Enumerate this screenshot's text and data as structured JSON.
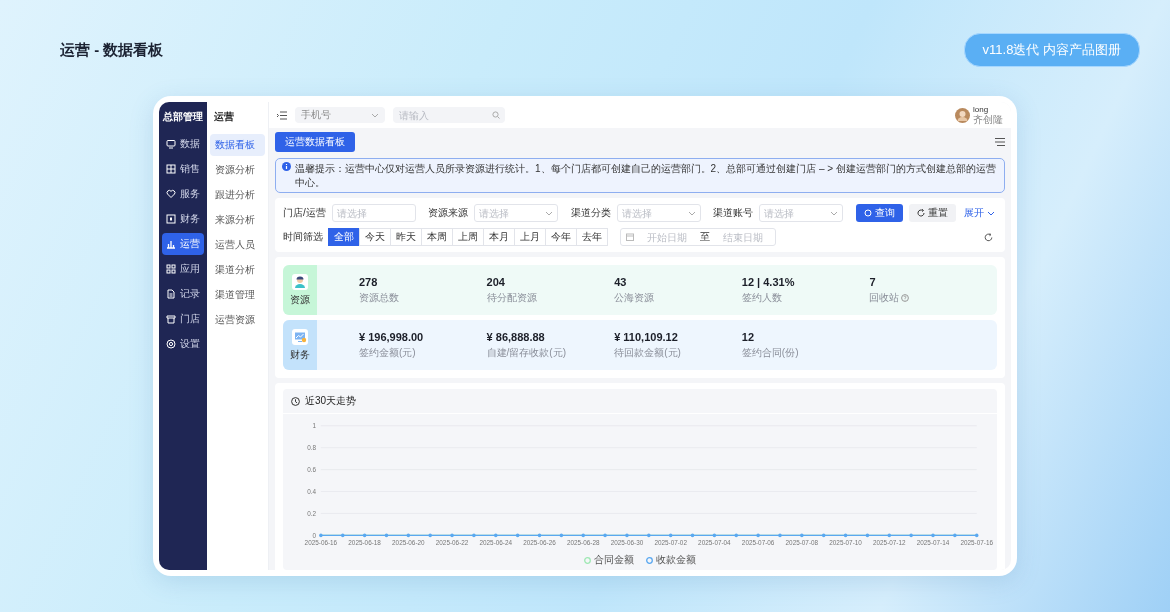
{
  "page": {
    "title": "运营 - 数据看板",
    "badge": "v11.8迭代 内容产品图册"
  },
  "app": {
    "brand": "总部管理",
    "nav": [
      {
        "label": "数据",
        "selected": false
      },
      {
        "label": "销售",
        "selected": false
      },
      {
        "label": "服务",
        "selected": false
      },
      {
        "label": "财务",
        "selected": false
      },
      {
        "label": "运营",
        "selected": true
      },
      {
        "label": "应用",
        "selected": false
      },
      {
        "label": "记录",
        "selected": false
      },
      {
        "label": "门店",
        "selected": false
      },
      {
        "label": "设置",
        "selected": false
      }
    ],
    "submenu": {
      "title": "运营",
      "items": [
        {
          "label": "数据看板",
          "selected": true
        },
        {
          "label": "资源分析",
          "selected": false
        },
        {
          "label": "跟进分析",
          "selected": false
        },
        {
          "label": "来源分析",
          "selected": false
        },
        {
          "label": "运营人员",
          "selected": false
        },
        {
          "label": "渠道分析",
          "selected": false
        },
        {
          "label": "渠道管理",
          "selected": false
        },
        {
          "label": "运营资源",
          "selected": false
        }
      ]
    },
    "topbar": {
      "field_select": "手机号",
      "search_placeholder": "请输入",
      "user": {
        "name": "long",
        "role": "齐创隆"
      }
    },
    "page_tab": "运营数据看板",
    "notice": "温馨提示：运营中心仅对运营人员所录资源进行统计。1、每个门店都可创建自己的运营部门。2、总部可通过创建门店 – > 创建运营部门的方式创建总部的运营中心。",
    "filters": [
      {
        "label": "门店/运营",
        "placeholder": "请选择",
        "kind": "input"
      },
      {
        "label": "资源来源",
        "placeholder": "请选择",
        "kind": "select"
      },
      {
        "label": "渠道分类",
        "placeholder": "请选择",
        "kind": "select"
      },
      {
        "label": "渠道账号",
        "placeholder": "请选择",
        "kind": "select"
      }
    ],
    "actions": {
      "query": "查询",
      "reset": "重置",
      "expand": "展开"
    },
    "time_filter": {
      "label": "时间筛选",
      "options": [
        {
          "label": "全部",
          "selected": true
        },
        {
          "label": "今天",
          "selected": false
        },
        {
          "label": "昨天",
          "selected": false
        },
        {
          "label": "本周",
          "selected": false
        },
        {
          "label": "上周",
          "selected": false
        },
        {
          "label": "本月",
          "selected": false
        },
        {
          "label": "上月",
          "selected": false
        },
        {
          "label": "今年",
          "selected": false
        },
        {
          "label": "去年",
          "selected": false
        }
      ],
      "date_range": {
        "start_placeholder": "开始日期",
        "separator": "至",
        "end_placeholder": "结束日期"
      }
    },
    "stats": [
      {
        "category": "资源",
        "kind": "resource",
        "items": [
          {
            "value": "278",
            "label": "资源总数",
            "help": false
          },
          {
            "value": "204",
            "label": "待分配资源",
            "help": false
          },
          {
            "value": "43",
            "label": "公海资源",
            "help": false
          },
          {
            "value": "12 | 4.31%",
            "label": "签约人数",
            "help": false
          },
          {
            "value": "7",
            "label": "回收站",
            "help": true
          }
        ]
      },
      {
        "category": "财务",
        "kind": "finance",
        "items": [
          {
            "value": "¥ 196,998.00",
            "label": "签约金额(元)",
            "help": false
          },
          {
            "value": "¥ 86,888.88",
            "label": "自建/留存收款(元)",
            "help": false
          },
          {
            "value": "¥ 110,109.12",
            "label": "待回款金额(元)",
            "help": false
          },
          {
            "value": "12",
            "label": "签约合同(份)",
            "help": false
          }
        ]
      }
    ],
    "trend": {
      "title": "近30天走势",
      "chart_data": {
        "type": "line",
        "categories": [
          "2025-06-16",
          null,
          "2025-06-18",
          null,
          "2025-06-20",
          null,
          "2025-06-22",
          null,
          "2025-06-24",
          null,
          "2025-06-26",
          null,
          "2025-06-28",
          null,
          "2025-06-30",
          null,
          "2025-07-02",
          null,
          "2025-07-04",
          null,
          "2025-07-06",
          null,
          "2025-07-08",
          null,
          "2025-07-10",
          null,
          "2025-07-12",
          null,
          "2025-07-14",
          null,
          "2025-07-16"
        ],
        "series": [
          {
            "name": "合同金额",
            "color": "#9fe8b4",
            "values": [
              0,
              0,
              0,
              0,
              0,
              0,
              0,
              0,
              0,
              0,
              0,
              0,
              0,
              0,
              0,
              0,
              0,
              0,
              0,
              0,
              0,
              0,
              0,
              0,
              0,
              0,
              0,
              0,
              0,
              0,
              0
            ]
          },
          {
            "name": "收款金额",
            "color": "#5aa8f0",
            "values": [
              0,
              0,
              0,
              0,
              0,
              0,
              0,
              0,
              0,
              0,
              0,
              0,
              0,
              0,
              0,
              0,
              0,
              0,
              0,
              0,
              0,
              0,
              0,
              0,
              0,
              0,
              0,
              0,
              0,
              0,
              0
            ]
          }
        ],
        "ylim": [
          0,
          1
        ],
        "yticks": [
          0,
          0.2,
          0.4,
          0.6,
          0.8,
          1
        ],
        "grid": true,
        "legend": "bottom"
      }
    }
  }
}
